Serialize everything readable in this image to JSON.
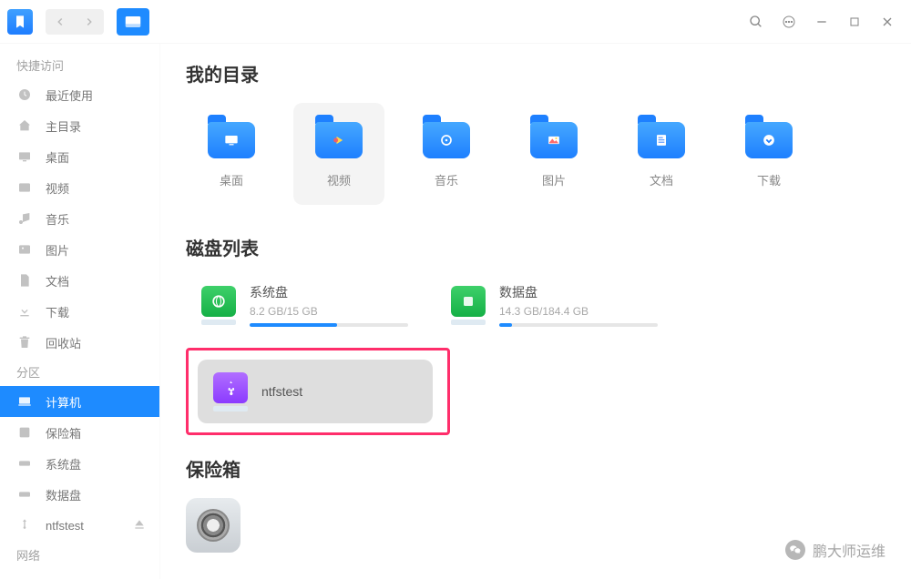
{
  "titlebar": {},
  "sidebar": {
    "quick_access_label": "快捷访问",
    "quick_items": [
      {
        "label": "最近使用",
        "icon": "clock"
      },
      {
        "label": "主目录",
        "icon": "home"
      },
      {
        "label": "桌面",
        "icon": "desktop"
      },
      {
        "label": "视频",
        "icon": "video"
      },
      {
        "label": "音乐",
        "icon": "music"
      },
      {
        "label": "图片",
        "icon": "image"
      },
      {
        "label": "文档",
        "icon": "doc"
      },
      {
        "label": "下载",
        "icon": "download"
      },
      {
        "label": "回收站",
        "icon": "trash"
      }
    ],
    "partition_label": "分区",
    "partition_items": [
      {
        "label": "计算机",
        "icon": "computer",
        "active": true
      },
      {
        "label": "保险箱",
        "icon": "vault"
      },
      {
        "label": "系统盘",
        "icon": "disk"
      },
      {
        "label": "数据盘",
        "icon": "disk"
      },
      {
        "label": "ntfstest",
        "icon": "usb",
        "eject": true
      }
    ],
    "network_label": "网络"
  },
  "main": {
    "my_dir_label": "我的目录",
    "dirs": [
      {
        "label": "桌面",
        "glyph": "desktop"
      },
      {
        "label": "视频",
        "glyph": "play",
        "hover": true
      },
      {
        "label": "音乐",
        "glyph": "music"
      },
      {
        "label": "图片",
        "glyph": "image"
      },
      {
        "label": "文档",
        "glyph": "doc"
      },
      {
        "label": "下载",
        "glyph": "download"
      }
    ],
    "disk_list_label": "磁盘列表",
    "disks": [
      {
        "name": "系统盘",
        "size": "8.2 GB/15 GB",
        "fill_pct": 55,
        "icon": "system"
      },
      {
        "name": "数据盘",
        "size": "14.3 GB/184.4 GB",
        "fill_pct": 8,
        "icon": "data"
      }
    ],
    "usb": {
      "name": "ntfstest"
    },
    "vault_label": "保险箱"
  },
  "watermark": "鹏大师运维"
}
